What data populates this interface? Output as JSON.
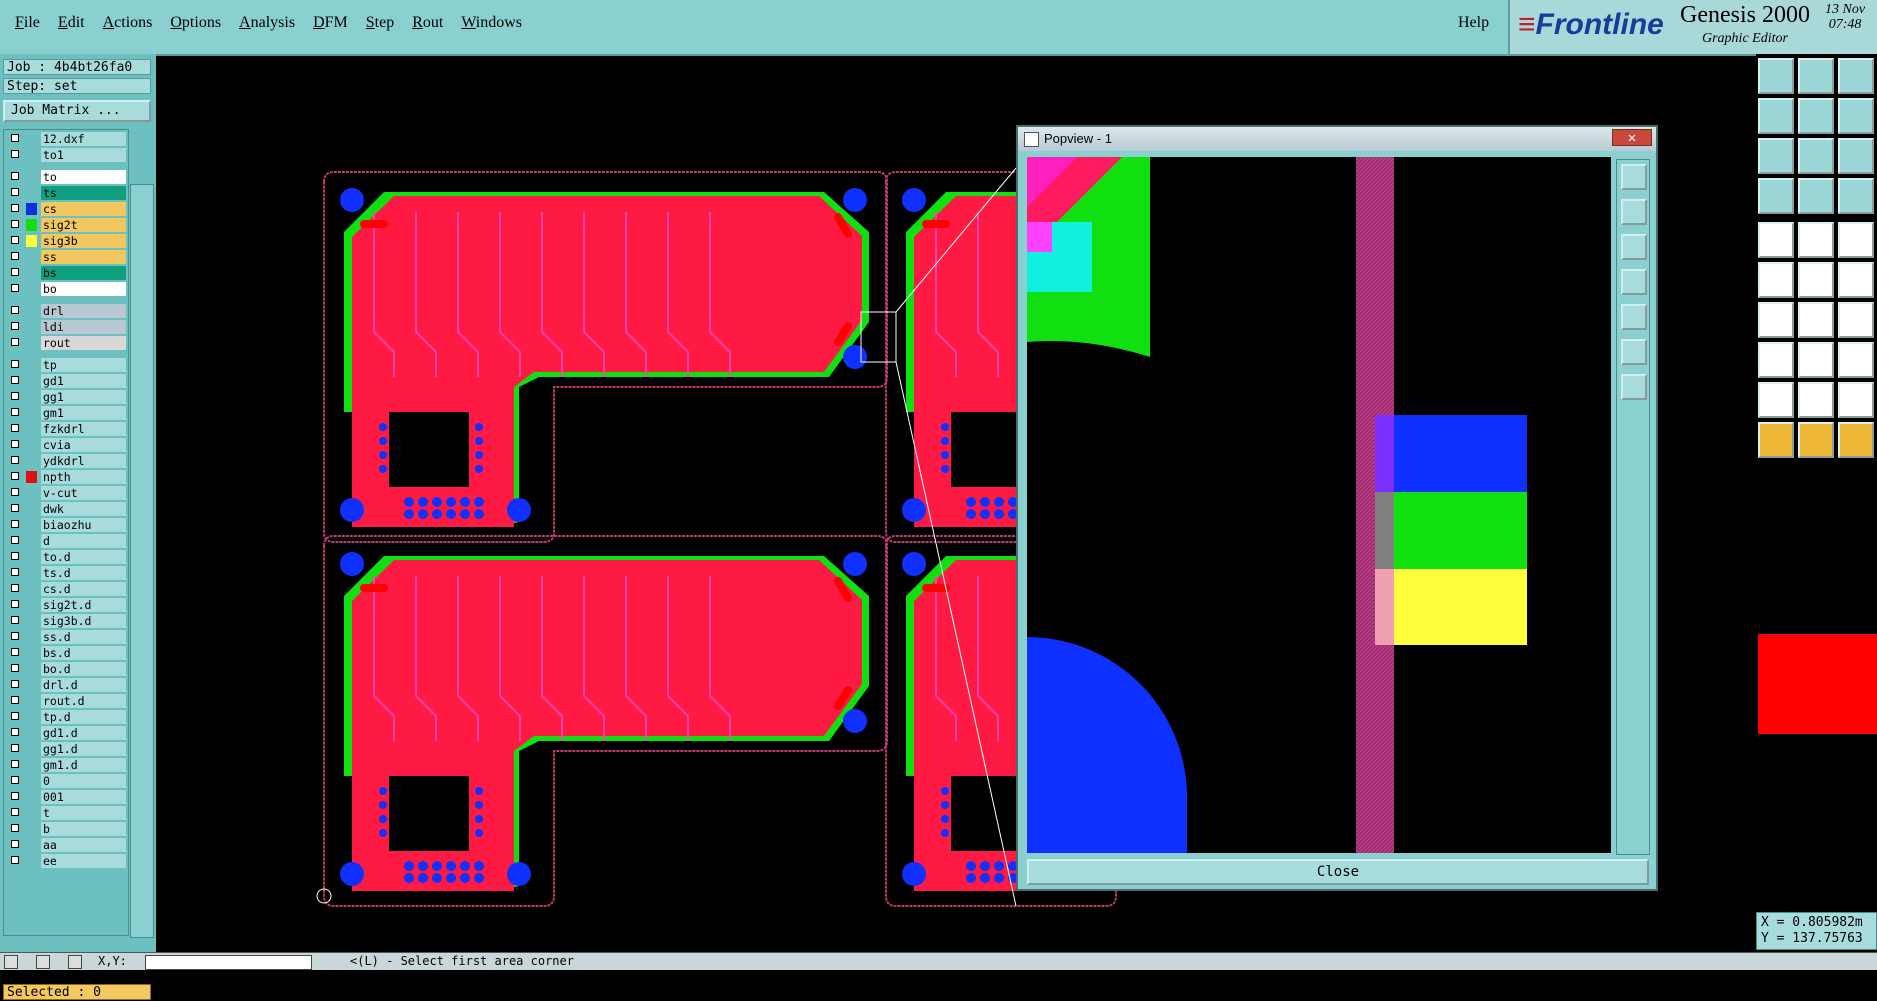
{
  "menubar": {
    "items": [
      "File",
      "Edit",
      "Actions",
      "Options",
      "Analysis",
      "DFM",
      "Step",
      "Rout",
      "Windows"
    ],
    "help": "Help"
  },
  "brand": {
    "logo": "Frontline",
    "product": "Genesis 2000",
    "subtitle": "Graphic Editor",
    "date": "13 Nov",
    "time": "07:48"
  },
  "job": {
    "label": "Job : 4b4bt26fa0",
    "step": "Step: set",
    "matrix_button": "Job Matrix ..."
  },
  "layers": [
    {
      "name": "12.dxf",
      "color": "",
      "bg": "#a8dcdc"
    },
    {
      "name": "to1",
      "color": "",
      "bg": "#a8dcdc"
    },
    {
      "name": "to",
      "color": "",
      "bg": "#ffffff"
    },
    {
      "name": "ts",
      "color": "",
      "bg": "#10a080"
    },
    {
      "name": "cs",
      "color": "#1030e0",
      "bg": "#f4c860"
    },
    {
      "name": "sig2t",
      "color": "#10e010",
      "bg": "#f4c860"
    },
    {
      "name": "sig3b",
      "color": "#ffff40",
      "bg": "#f4c860"
    },
    {
      "name": "ss",
      "color": "",
      "bg": "#f4c860"
    },
    {
      "name": "bs",
      "color": "",
      "bg": "#10a080"
    },
    {
      "name": "bo",
      "color": "",
      "bg": "#ffffff"
    },
    {
      "name": "drl",
      "color": "",
      "bg": "#b8c8d0"
    },
    {
      "name": "ldi",
      "color": "",
      "bg": "#b8c8d0"
    },
    {
      "name": "rout",
      "color": "",
      "bg": "#d8d8d8"
    },
    {
      "name": "tp",
      "color": "",
      "bg": "#a8dcdc"
    },
    {
      "name": "gd1",
      "color": "",
      "bg": "#a8dcdc"
    },
    {
      "name": "gg1",
      "color": "",
      "bg": "#a8dcdc"
    },
    {
      "name": "gm1",
      "color": "",
      "bg": "#a8dcdc"
    },
    {
      "name": "fzkdrl",
      "color": "",
      "bg": "#a8dcdc"
    },
    {
      "name": "cvia",
      "color": "",
      "bg": "#a8dcdc"
    },
    {
      "name": "ydkdrl",
      "color": "",
      "bg": "#a8dcdc"
    },
    {
      "name": "npth",
      "color": "#e01010",
      "bg": "#a8dcdc"
    },
    {
      "name": "v-cut",
      "color": "",
      "bg": "#a8dcdc"
    },
    {
      "name": "dwk",
      "color": "",
      "bg": "#a8dcdc"
    },
    {
      "name": "biaozhu",
      "color": "",
      "bg": "#a8dcdc"
    },
    {
      "name": "d",
      "color": "",
      "bg": "#a8dcdc"
    },
    {
      "name": "to.d",
      "color": "",
      "bg": "#a8dcdc"
    },
    {
      "name": "ts.d",
      "color": "",
      "bg": "#a8dcdc"
    },
    {
      "name": "cs.d",
      "color": "",
      "bg": "#a8dcdc"
    },
    {
      "name": "sig2t.d",
      "color": "",
      "bg": "#a8dcdc"
    },
    {
      "name": "sig3b.d",
      "color": "",
      "bg": "#a8dcdc"
    },
    {
      "name": "ss.d",
      "color": "",
      "bg": "#a8dcdc"
    },
    {
      "name": "bs.d",
      "color": "",
      "bg": "#a8dcdc"
    },
    {
      "name": "bo.d",
      "color": "",
      "bg": "#a8dcdc"
    },
    {
      "name": "drl.d",
      "color": "",
      "bg": "#a8dcdc"
    },
    {
      "name": "rout.d",
      "color": "",
      "bg": "#a8dcdc"
    },
    {
      "name": "tp.d",
      "color": "",
      "bg": "#a8dcdc"
    },
    {
      "name": "gd1.d",
      "color": "",
      "bg": "#a8dcdc"
    },
    {
      "name": "gg1.d",
      "color": "",
      "bg": "#a8dcdc"
    },
    {
      "name": "gm1.d",
      "color": "",
      "bg": "#a8dcdc"
    },
    {
      "name": "0",
      "color": "",
      "bg": "#a8dcdc"
    },
    {
      "name": "001",
      "color": "",
      "bg": "#a8dcdc"
    },
    {
      "name": "t",
      "color": "",
      "bg": "#a8dcdc"
    },
    {
      "name": "b",
      "color": "",
      "bg": "#a8dcdc"
    },
    {
      "name": "aa",
      "color": "",
      "bg": "#a8dcdc"
    },
    {
      "name": "ee",
      "color": "",
      "bg": "#a8dcdc"
    }
  ],
  "selected": "Selected : 0",
  "popview": {
    "title": "Popview - 1",
    "close_label": "Close",
    "close_x": "✕"
  },
  "coords": {
    "x": "X = 0.805982m",
    "y": "Y = 137.75763"
  },
  "status": {
    "xy_label": "X,Y:",
    "message": "<(L) - Select first area corner"
  },
  "colors": {
    "copper": "#ff1a44",
    "trace": "#ff40b0",
    "mask": "#10e010",
    "pad": "#1030ff",
    "outline": "#c03878"
  }
}
